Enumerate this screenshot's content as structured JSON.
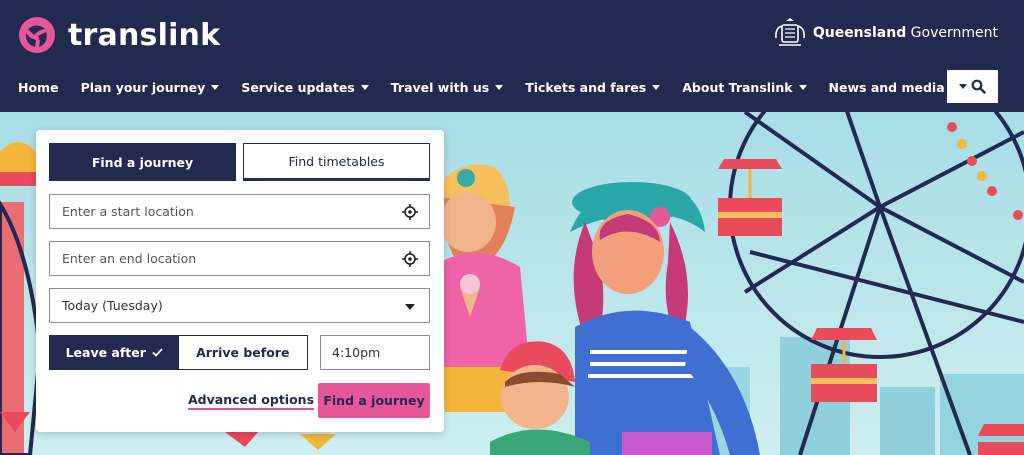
{
  "brand": {
    "name": "translink",
    "accent": "#e8569a",
    "navy": "#222a4f"
  },
  "government": {
    "bold": "Queensland",
    "rest": " Government",
    "icon": "queensland-crest-icon"
  },
  "nav": {
    "items": [
      {
        "label": "Home",
        "has_menu": false
      },
      {
        "label": "Plan your journey",
        "has_menu": true
      },
      {
        "label": "Service updates",
        "has_menu": true
      },
      {
        "label": "Travel with us",
        "has_menu": true
      },
      {
        "label": "Tickets and fares",
        "has_menu": true
      },
      {
        "label": "About Translink",
        "has_menu": true
      },
      {
        "label": "News and media",
        "has_menu": true
      }
    ],
    "search_icon": "search-icon"
  },
  "planner": {
    "tabs": [
      {
        "label": "Find a journey",
        "active": true
      },
      {
        "label": "Find timetables",
        "active": false
      }
    ],
    "start_placeholder": "Enter a start location",
    "end_placeholder": "Enter an end location",
    "date_value": "Today (Tuesday)",
    "leave_after": "Leave after",
    "arrive_before": "Arrive before",
    "time_value": "4:10pm",
    "advanced_options": "Advanced options",
    "find_button": "Find a journey"
  }
}
